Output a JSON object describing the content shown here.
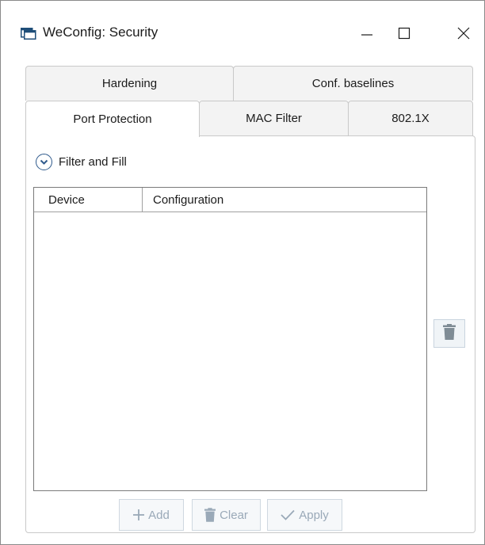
{
  "window": {
    "title": "WeConfig: Security",
    "icon": "window-icon",
    "controls": [
      "minimize-icon",
      "maximize-icon",
      "close-icon"
    ]
  },
  "tabs_row1": [
    {
      "label": "Hardening"
    },
    {
      "label": "Conf. baselines"
    }
  ],
  "tabs_row2": [
    {
      "label": "Port Protection",
      "selected": true
    },
    {
      "label": "MAC Filter"
    },
    {
      "label": "802.1X"
    }
  ],
  "filter": {
    "label": "Filter and Fill",
    "icon": "chevron-down-circle-icon"
  },
  "table": {
    "columns": [
      "Device",
      "Configuration"
    ],
    "rows": []
  },
  "side_actions": {
    "delete_icon": "trash-icon"
  },
  "actions": {
    "add_label": "Add",
    "clear_label": "Clear",
    "apply_label": "Apply"
  },
  "colors": {
    "accent": "#2f5a8c",
    "disabled_text": "#9aa9b8",
    "icon_gray": "#7f8c95"
  }
}
